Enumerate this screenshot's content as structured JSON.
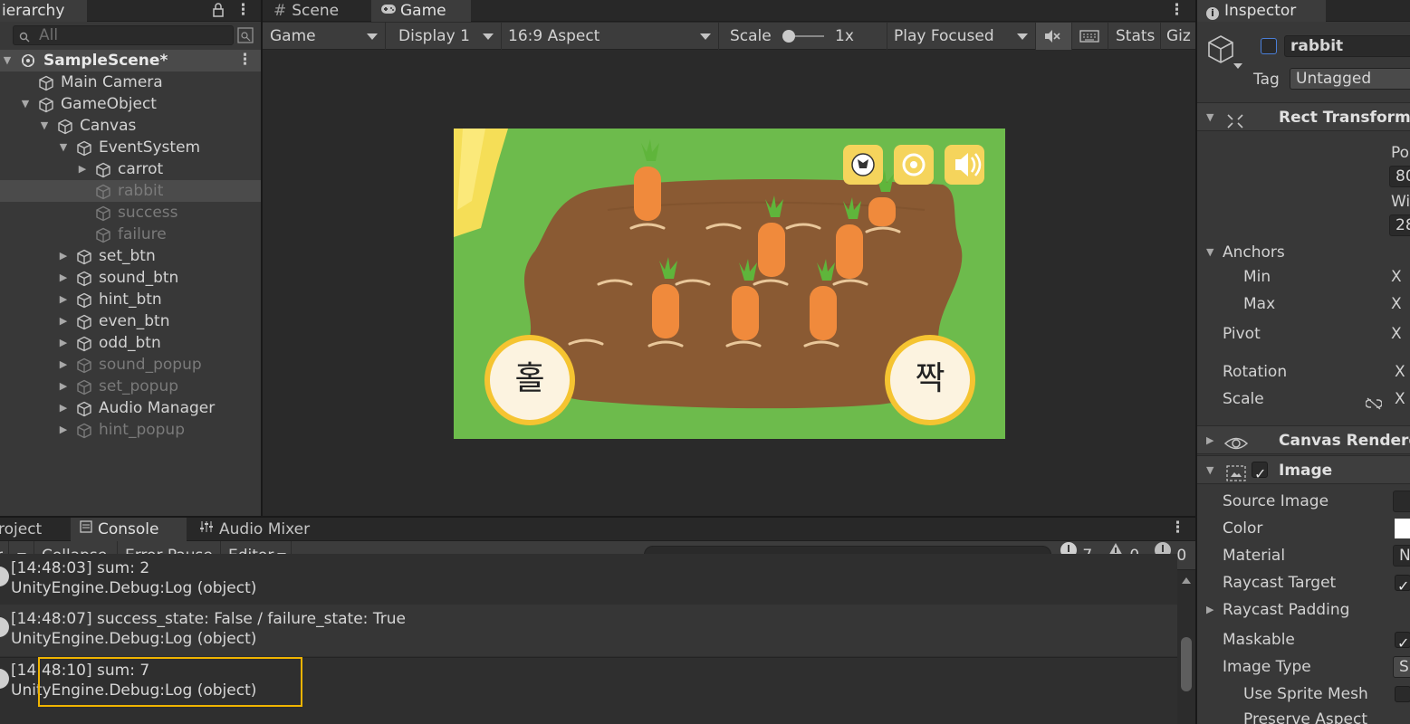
{
  "hierarchy": {
    "tab": "ierarchy",
    "search_placeholder": "All",
    "scene": "SampleScene*",
    "items": [
      {
        "label": "Main Camera",
        "depth": 1,
        "arrow": "",
        "dim": false
      },
      {
        "label": "GameObject",
        "depth": 1,
        "arrow": "down",
        "dim": false
      },
      {
        "label": "Canvas",
        "depth": 2,
        "arrow": "down",
        "dim": false
      },
      {
        "label": "EventSystem",
        "depth": 3,
        "arrow": "down",
        "dim": false
      },
      {
        "label": "carrot",
        "depth": 4,
        "arrow": "right",
        "dim": false
      },
      {
        "label": "rabbit",
        "depth": 4,
        "arrow": "",
        "dim": true,
        "selected": true
      },
      {
        "label": "success",
        "depth": 4,
        "arrow": "",
        "dim": true
      },
      {
        "label": "failure",
        "depth": 4,
        "arrow": "",
        "dim": true
      },
      {
        "label": "set_btn",
        "depth": 3,
        "arrow": "right",
        "dim": false
      },
      {
        "label": "sound_btn",
        "depth": 3,
        "arrow": "right",
        "dim": false
      },
      {
        "label": "hint_btn",
        "depth": 3,
        "arrow": "right",
        "dim": false
      },
      {
        "label": "even_btn",
        "depth": 3,
        "arrow": "right",
        "dim": false
      },
      {
        "label": "odd_btn",
        "depth": 3,
        "arrow": "right",
        "dim": false
      },
      {
        "label": "sound_popup",
        "depth": 3,
        "arrow": "right",
        "dim": true
      },
      {
        "label": "set_popup",
        "depth": 3,
        "arrow": "right",
        "dim": true
      },
      {
        "label": "Audio Manager",
        "depth": 3,
        "arrow": "right",
        "dim": false
      },
      {
        "label": "hint_popup",
        "depth": 3,
        "arrow": "right",
        "dim": true
      }
    ]
  },
  "game_view": {
    "tabs": {
      "scene": "Scene",
      "game": "Game"
    },
    "toolbar": {
      "mode": "Game",
      "display": "Display 1",
      "aspect": "16:9 Aspect",
      "scale_label": "Scale",
      "scale_value": "1x",
      "play": "Play Focused",
      "stats": "Stats",
      "gizmos": "Giz"
    },
    "buttons": {
      "odd": "홀",
      "even": "짝"
    }
  },
  "console": {
    "tabs": {
      "project": "roject",
      "console": "Console",
      "mixer": "Audio Mixer"
    },
    "toolbar": {
      "collapse": "Collapse",
      "error_pause": "Error Pause",
      "editor": "Editor"
    },
    "counts": {
      "log": "7",
      "warn": "0",
      "error": "0"
    },
    "entries": [
      {
        "l1": "[14:48:03] sum: 2",
        "l2": "UnityEngine.Debug:Log (object)"
      },
      {
        "l1": "[14:48:07] success_state: False / failure_state: True",
        "l2": "UnityEngine.Debug:Log (object)"
      },
      {
        "l1": "[14:48:10] sum: 7",
        "l2": "UnityEngine.Debug:Log (object)"
      }
    ]
  },
  "inspector": {
    "tab": "Inspector",
    "object_name": "rabbit",
    "tag_label": "Tag",
    "tag_value": "Untagged",
    "rect_transform": "Rect Transform",
    "pos_label": "Po",
    "pos_value": "80",
    "width_label": "Wi",
    "width_value": "28",
    "anchors": "Anchors",
    "min": "Min",
    "max": "Max",
    "pivot": "Pivot",
    "rotation": "Rotation",
    "scale": "Scale",
    "axis_x": "X",
    "canvas_renderer": "Canvas Rendere",
    "image": "Image",
    "image_fields": {
      "source_image": "Source Image",
      "color": "Color",
      "material": "Material",
      "material_value": "N",
      "raycast_target": "Raycast Target",
      "raycast_padding": "Raycast Padding",
      "maskable": "Maskable",
      "image_type": "Image Type",
      "image_type_value": "S",
      "use_sprite_mesh": "Use Sprite Mesh",
      "preserve_aspect": "Preserve Aspect"
    }
  },
  "colors": {
    "highlight_box": "#f0b400",
    "grass": "#6dbb4c",
    "soil": "#8a5a33",
    "carrot": "#f08a3c",
    "button_ring": "#f5c431"
  }
}
